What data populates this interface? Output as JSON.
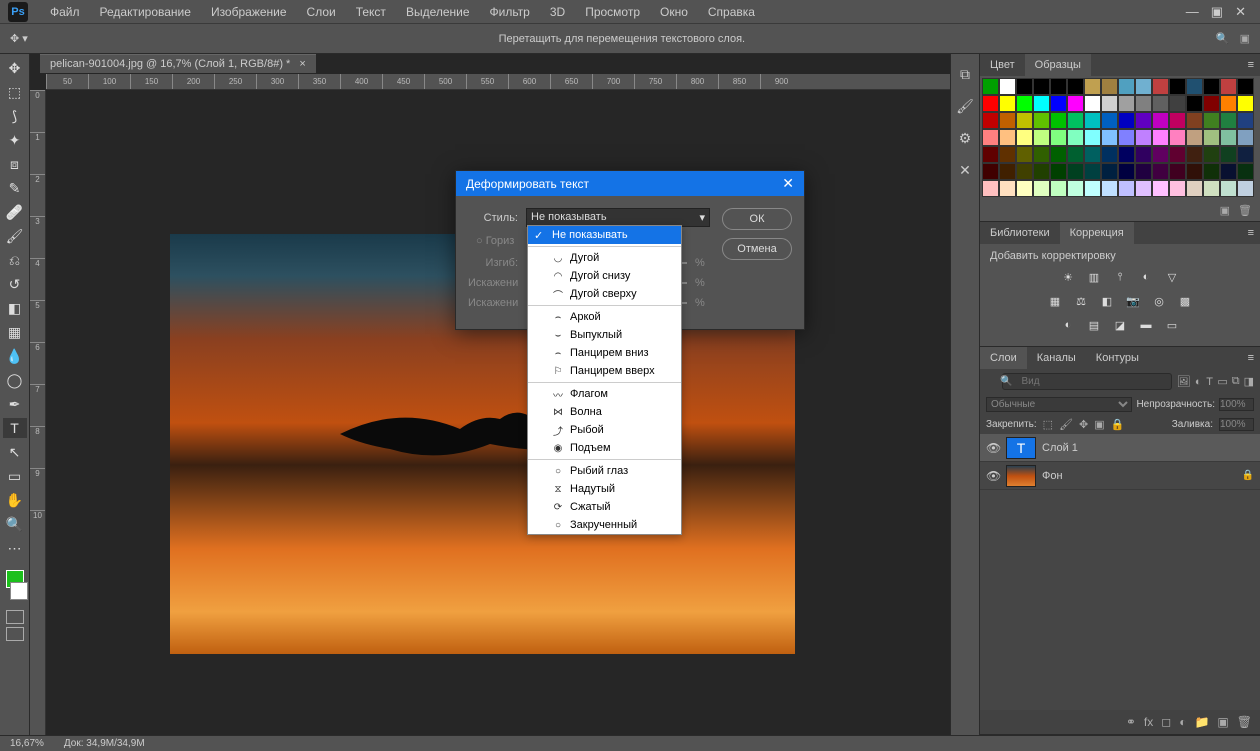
{
  "menu": {
    "items": [
      "Файл",
      "Редактирование",
      "Изображение",
      "Слои",
      "Текст",
      "Выделение",
      "Фильтр",
      "3D",
      "Просмотр",
      "Окно",
      "Справка"
    ],
    "logo": "Ps"
  },
  "optionsbar": {
    "hint": "Перетащить для перемещения текстового слоя."
  },
  "document": {
    "tab_title": "pelican-901004.jpg @ 16,7% (Слой 1, RGB/8#) *",
    "ruler_h": [
      "50",
      "100",
      "150",
      "200",
      "250",
      "300",
      "350",
      "400",
      "450",
      "500",
      "550",
      "600",
      "650",
      "700",
      "750",
      "800",
      "850",
      "900"
    ],
    "ruler_v": [
      "0",
      "1",
      "2",
      "3",
      "4",
      "5",
      "6",
      "7",
      "8",
      "9",
      "10"
    ]
  },
  "panels": {
    "color_tabs": [
      "Цвет",
      "Образцы"
    ],
    "lib_tabs": [
      "Библиотеки",
      "Коррекция"
    ],
    "adjust_label": "Добавить корректировку",
    "layers_tabs": [
      "Слои",
      "Каналы",
      "Контуры"
    ],
    "layers_search_ph": "Вид",
    "blend_mode": "Обычные",
    "opacity_label": "Непрозрачность:",
    "opacity_val": "100%",
    "lock_label": "Закрепить:",
    "fill_label": "Заливка:",
    "fill_val": "100%",
    "layer_rows": [
      {
        "name": "Слой 1",
        "type": "text",
        "locked": false
      },
      {
        "name": "Фон",
        "type": "image",
        "locked": true
      }
    ]
  },
  "statusbar": {
    "zoom": "16,67%",
    "docsize": "Док: 34,9M/34,9M"
  },
  "dialog": {
    "title": "Деформировать текст",
    "style_label": "Стиль:",
    "style_value": "Не показывать",
    "orient_h": "Гориз",
    "bend_label": "Изгиб:",
    "distort_h": "Искажени",
    "distort_v": "Искажени",
    "unit": "%",
    "ok": "ОК",
    "cancel": "Отмена"
  },
  "dropdown": {
    "groups": [
      [
        {
          "label": "Не показывать",
          "sel": true
        }
      ],
      [
        {
          "label": "Дугой"
        },
        {
          "label": "Дугой снизу"
        },
        {
          "label": "Дугой сверху"
        }
      ],
      [
        {
          "label": "Аркой"
        },
        {
          "label": "Выпуклый"
        },
        {
          "label": "Панцирем вниз"
        },
        {
          "label": "Панцирем вверх"
        }
      ],
      [
        {
          "label": "Флагом"
        },
        {
          "label": "Волна"
        },
        {
          "label": "Рыбой"
        },
        {
          "label": "Подъем"
        }
      ],
      [
        {
          "label": "Рыбий глаз"
        },
        {
          "label": "Надутый"
        },
        {
          "label": "Сжатый"
        },
        {
          "label": "Закрученный"
        }
      ]
    ]
  },
  "swatches": [
    "#00a000",
    "#ffffff",
    "#000000",
    "#000000",
    "#000000",
    "#000000",
    "#c0a050",
    "#a08040",
    "#50a0c0",
    "#70b0d0",
    "#c04040",
    "#000000",
    "#205070",
    "#000000",
    "#c04040",
    "#000000",
    "#ff0000",
    "#ffff00",
    "#00ff00",
    "#00ffff",
    "#0000ff",
    "#ff00ff",
    "#ffffff",
    "#d0d0d0",
    "#a0a0a0",
    "#808080",
    "#606060",
    "#404040",
    "#000000",
    "#800000",
    "#ff8000",
    "#ffff00",
    "#c00000",
    "#c06000",
    "#c0c000",
    "#60c000",
    "#00c000",
    "#00c060",
    "#00c0c0",
    "#0060c0",
    "#0000c0",
    "#6000c0",
    "#c000c0",
    "#c00060",
    "#804020",
    "#408020",
    "#208040",
    "#204080",
    "#ff8080",
    "#ffc080",
    "#ffff80",
    "#c0ff80",
    "#80ff80",
    "#80ffc0",
    "#80ffff",
    "#80c0ff",
    "#8080ff",
    "#c080ff",
    "#ff80ff",
    "#ff80c0",
    "#c0a080",
    "#a0c080",
    "#80c0a0",
    "#80a0c0",
    "#600000",
    "#603000",
    "#606000",
    "#306000",
    "#006000",
    "#006030",
    "#006060",
    "#003060",
    "#000060",
    "#300060",
    "#600060",
    "#600030",
    "#402010",
    "#204010",
    "#104020",
    "#102040",
    "#400000",
    "#402000",
    "#404000",
    "#204000",
    "#004000",
    "#004020",
    "#004040",
    "#002040",
    "#000040",
    "#200040",
    "#400040",
    "#400020",
    "#301008",
    "#103008",
    "#081030",
    "#083010",
    "#ffc0c0",
    "#ffe0c0",
    "#ffffc0",
    "#e0ffc0",
    "#c0ffc0",
    "#c0ffe0",
    "#c0ffff",
    "#c0e0ff",
    "#c0c0ff",
    "#e0c0ff",
    "#ffc0ff",
    "#ffc0e0",
    "#e0d0c0",
    "#d0e0c0",
    "#c0e0d0",
    "#c0d0e0"
  ]
}
